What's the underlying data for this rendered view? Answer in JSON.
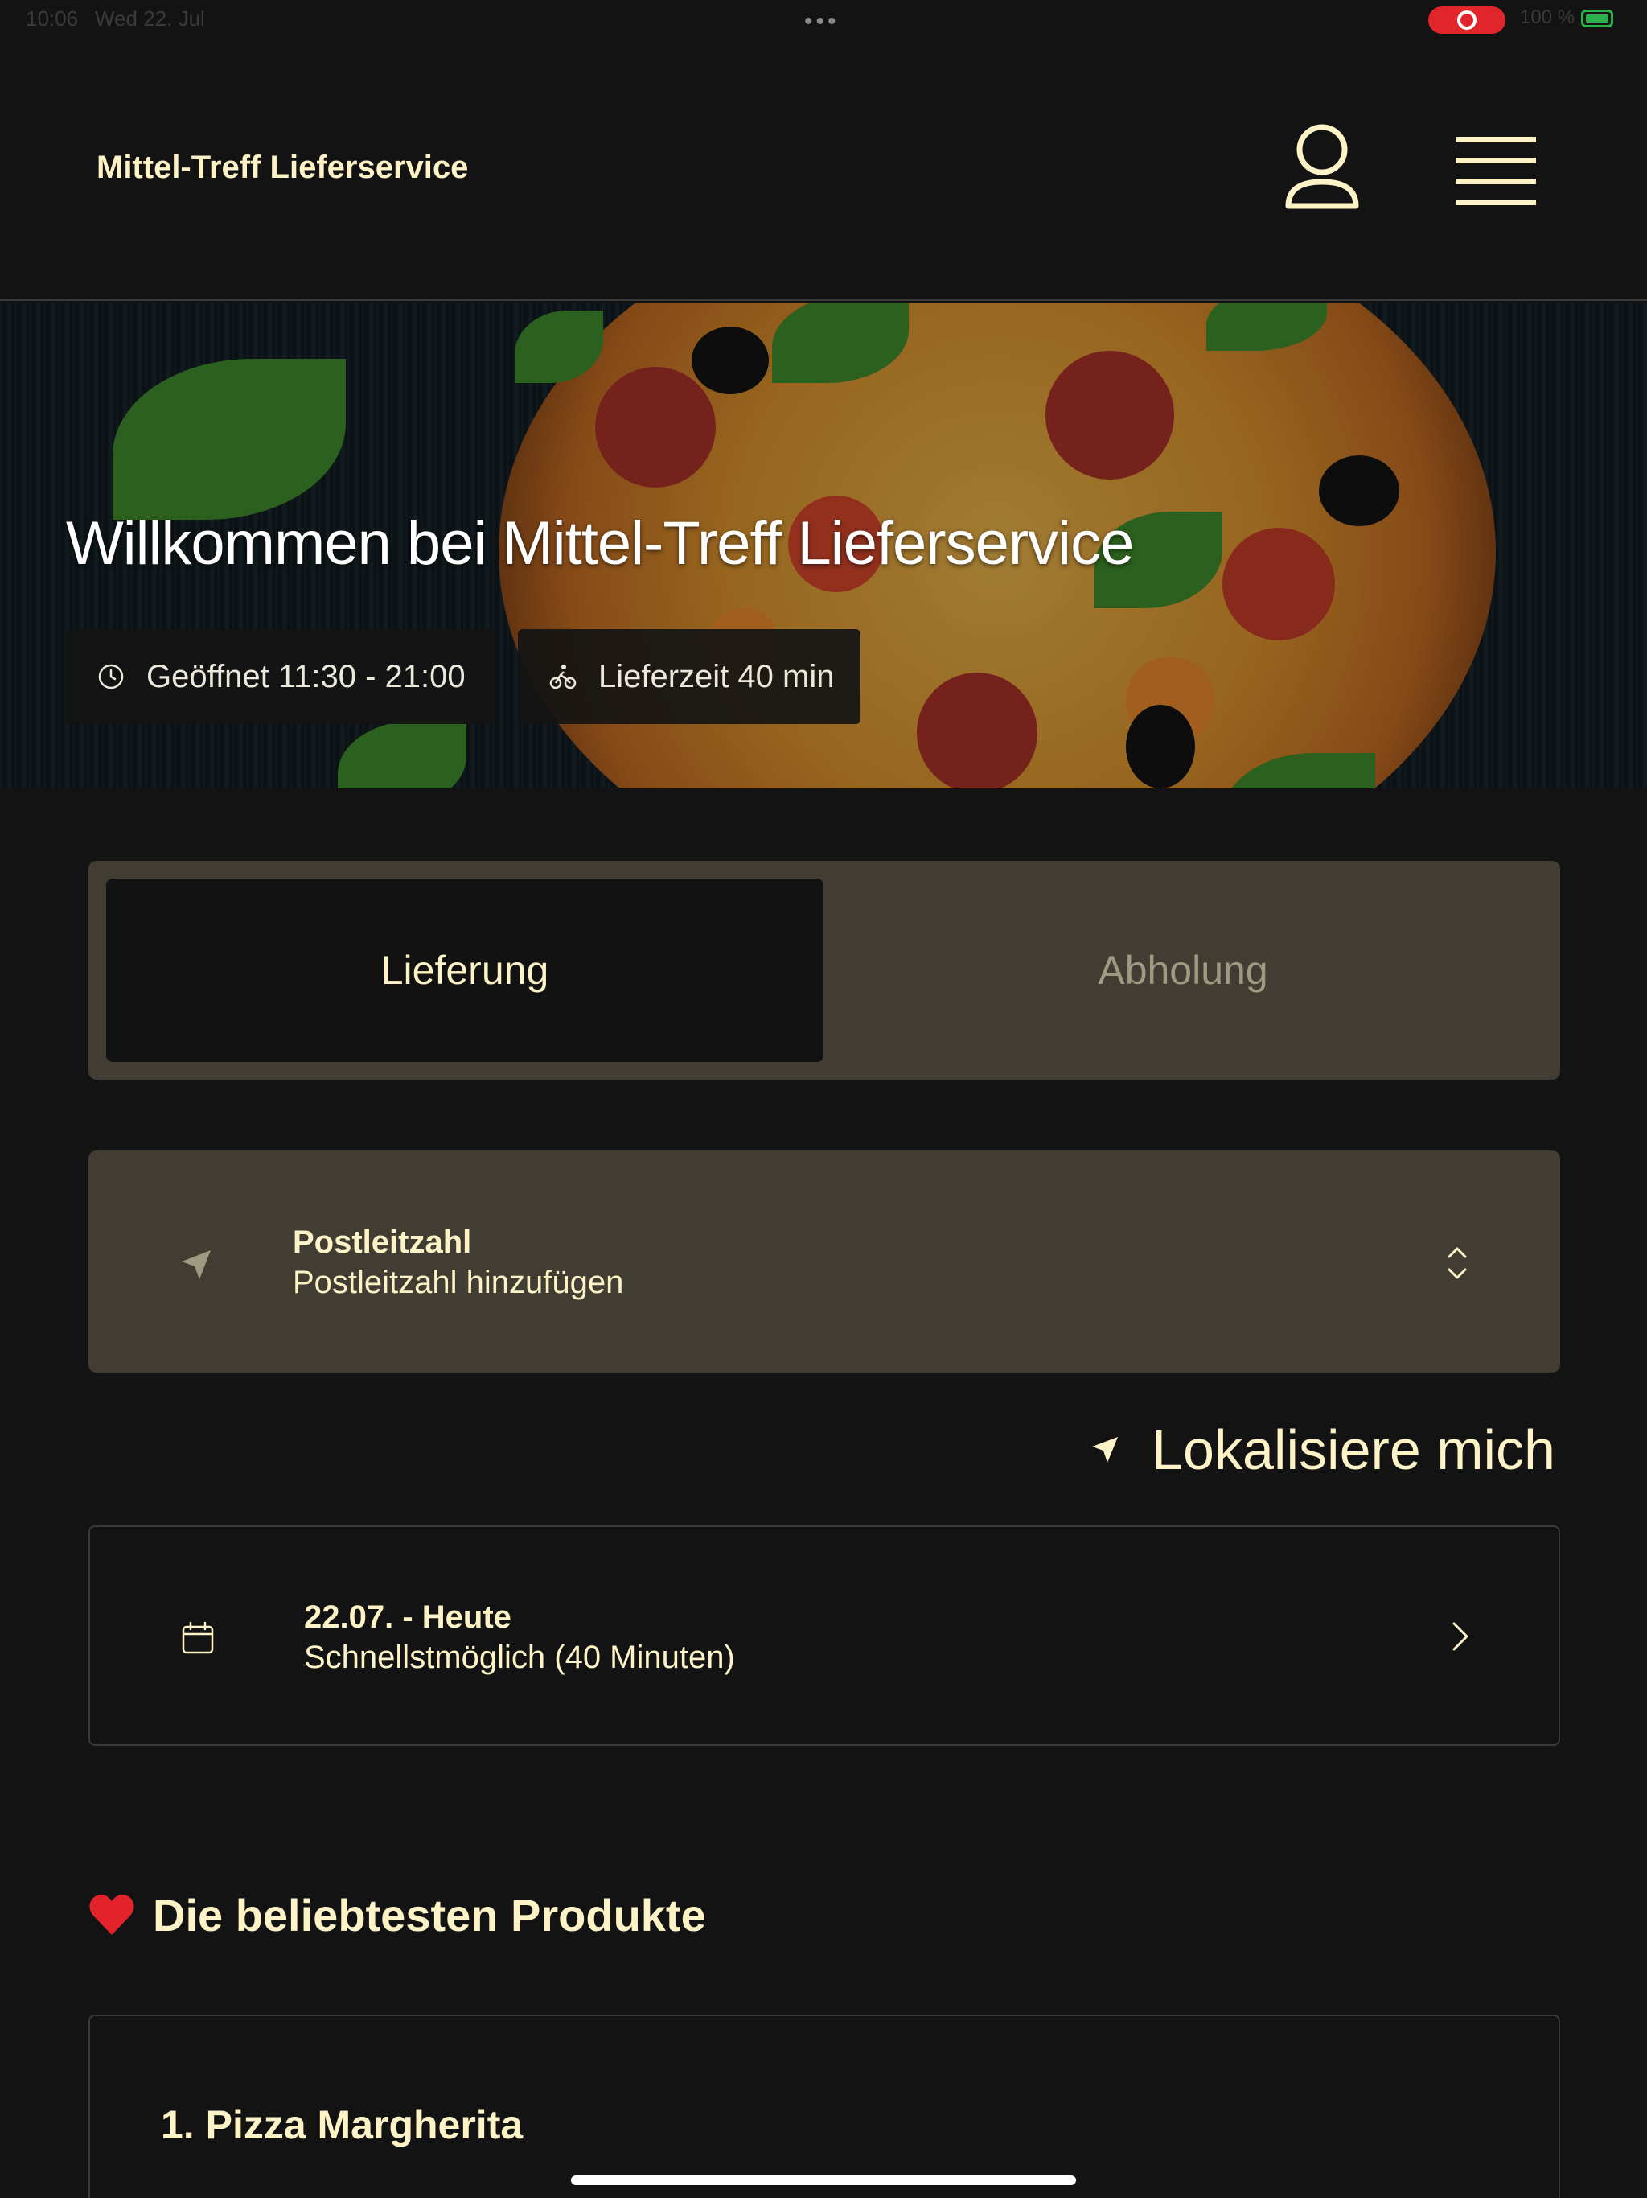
{
  "status_bar": {
    "time": "10:06",
    "date": "Wed 22. Jul",
    "battery": "100 %"
  },
  "header": {
    "brand": "Mittel-Treff Lieferservice",
    "account_icon": "user-icon",
    "menu_icon": "hamburger-icon"
  },
  "hero": {
    "title": "Willkommen bei Mittel-Treff Lieferservice",
    "opening_hours": "Geöffnet 11:30 - 21:00",
    "delivery_time": "Lieferzeit 40 min",
    "background": "pizza-photo"
  },
  "order_mode": {
    "tabs": [
      "Lieferung",
      "Abholung"
    ],
    "selected": "Lieferung"
  },
  "postal_code": {
    "label": "Postleitzahl",
    "placeholder": "Postleitzahl hinzufügen"
  },
  "locate": {
    "label": "Lokalisiere mich"
  },
  "schedule": {
    "date": "22.07. - Heute",
    "time": "Schnellstmöglich (40 Minuten)"
  },
  "popular": {
    "title": "Die beliebtesten Produkte",
    "products": [
      {
        "name": "1. Pizza Margherita"
      }
    ]
  },
  "colors": {
    "background": "#131313",
    "accent_text": "#fdf3c6",
    "panel": "#413d33",
    "record": "#e0262a",
    "battery": "#2bb24c"
  }
}
